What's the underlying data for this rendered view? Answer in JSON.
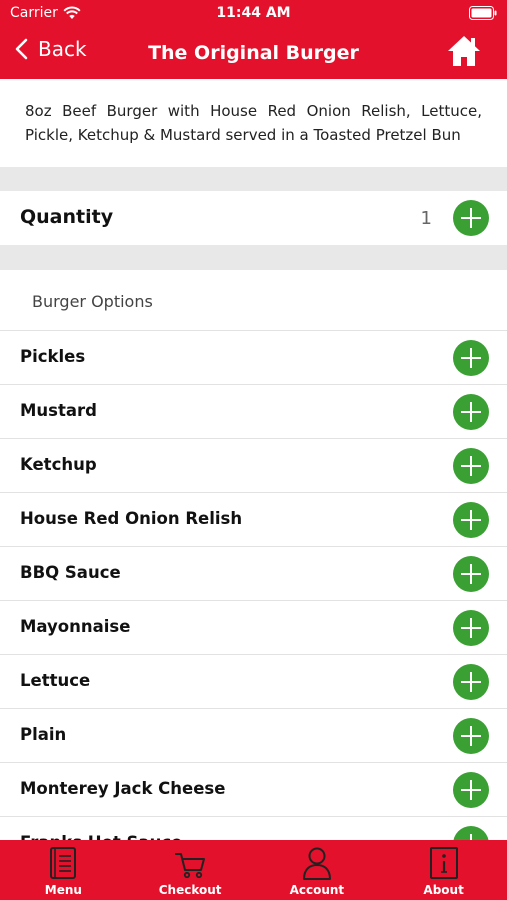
{
  "status_bar": {
    "carrier": "Carrier",
    "time": "11:44 AM"
  },
  "nav": {
    "back_label": "Back",
    "title": "The Original Burger"
  },
  "description": "8oz Beef Burger with House Red Onion Relish, Lettuce, Pickle, Ketchup & Mustard served in a Toasted Pretzel Bun",
  "quantity": {
    "label": "Quantity",
    "value": "1"
  },
  "options_section": {
    "header": "Burger Options",
    "items": [
      {
        "label": "Pickles"
      },
      {
        "label": "Mustard"
      },
      {
        "label": "Ketchup"
      },
      {
        "label": "House Red Onion Relish"
      },
      {
        "label": "BBQ Sauce"
      },
      {
        "label": "Mayonnaise"
      },
      {
        "label": "Lettuce"
      },
      {
        "label": "Plain"
      },
      {
        "label": "Monterey Jack Cheese"
      },
      {
        "label": "Franks Hot Sauce"
      }
    ]
  },
  "tabs": [
    {
      "label": "Menu",
      "icon": "menu-book-icon"
    },
    {
      "label": "Checkout",
      "icon": "cart-icon"
    },
    {
      "label": "Account",
      "icon": "user-icon"
    },
    {
      "label": "About",
      "icon": "info-icon"
    }
  ],
  "colors": {
    "brand_red": "#e3112b",
    "add_green": "#3aa033",
    "separator_gray": "#e8e8e8"
  }
}
